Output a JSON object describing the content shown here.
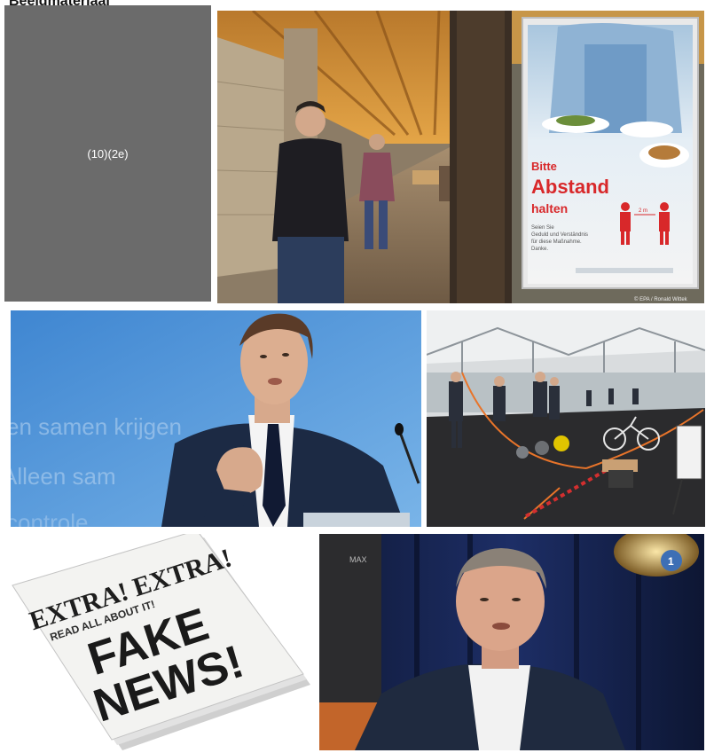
{
  "page": {
    "title": "Beeldmateriaal"
  },
  "tiles": {
    "placeholder": {
      "label": "(10)(2e)"
    },
    "restaurant": {
      "sign_line1": "Bitte",
      "sign_line2": "Abstand",
      "sign_line3": "halten",
      "sign_small1": "Seien Sie",
      "sign_small2": "Geduld und Verständnis",
      "sign_small3": "für diese Maßnahme.",
      "sign_small4": "Danke.",
      "sign_distance": "2 m",
      "credit": "© EPA / Ronald Wittek"
    },
    "minister": {
      "bg_line1": "en samen krijgen",
      "bg_line2": "Alleen sam",
      "bg_line3": "controle"
    },
    "gym": {},
    "fakenews": {
      "line1": "EXTRA! EXTRA!",
      "line2": "READ ALL ABOUT IT!",
      "line3": "FAKE",
      "line4": "NEWS!"
    },
    "talkshow": {
      "max_logo": "MAX",
      "channel_logo": "1"
    }
  },
  "colors": {
    "placeholder_bg": "#6b6b6b",
    "sign_red": "#d8282a",
    "sky_blue": "#4f95d6",
    "suit_navy": "#1c2a44",
    "barrier_orange": "#e8742a"
  }
}
